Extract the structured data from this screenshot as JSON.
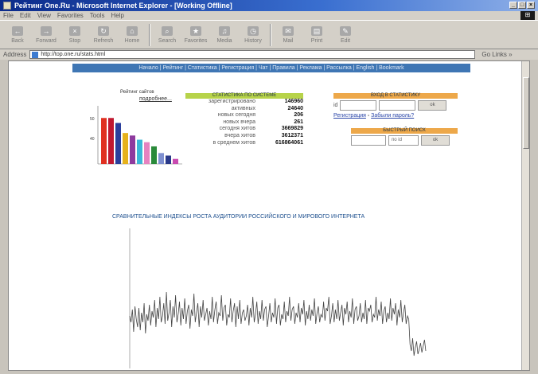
{
  "window": {
    "title": "Рейтинг One.Ru - Microsoft Internet Explorer - [Working Offline]"
  },
  "menu": [
    "File",
    "Edit",
    "View",
    "Favorites",
    "Tools",
    "Help"
  ],
  "toolbar": [
    "Back",
    "Forward",
    "Stop",
    "Refresh",
    "Home",
    "Search",
    "Favorites",
    "Media",
    "History",
    "Mail",
    "Print",
    "Edit"
  ],
  "address": {
    "label": "Address",
    "url": "http://top.one.ru/stats.html",
    "go": "Go  Links »"
  },
  "nav": {
    "text": "Начало | Рейтинг | Статистика | Регистрация | Чат | Правила | Реклама | Рассылка | English | Bookmark"
  },
  "mini_chart": {
    "title": "Рейтинг сайтов",
    "more": "подробнее...",
    "ymax": "50",
    "ymid": "40",
    "colors": [
      "#e03020",
      "#c01830",
      "#2b3f9c",
      "#e6b21c",
      "#8e3b9e",
      "#3bb8d8",
      "#e682c0",
      "#2a8a3a",
      "#7e8fd0",
      "#2a3a8a",
      "#c84ab0"
    ],
    "chart_data": {
      "type": "bar",
      "values": [
        55,
        55,
        49,
        37,
        34,
        29,
        26,
        21,
        13,
        10,
        6
      ]
    }
  },
  "stats": {
    "header": "СТАТИСТИКА ПО СИСТЕМЕ",
    "rows": [
      {
        "label": "зарегистрировано",
        "value": "146960"
      },
      {
        "label": "активных",
        "value": "24640"
      },
      {
        "label": "новых сегодня",
        "value": "206"
      },
      {
        "label": "новых вчера",
        "value": "261"
      },
      {
        "label": "сегодня хитов",
        "value": "3669829"
      },
      {
        "label": "вчера хитов",
        "value": "3612371"
      },
      {
        "label": "в среднем хитов",
        "value": "616864061"
      }
    ]
  },
  "login": {
    "header": "ВХОД В СТАТИСТИКУ",
    "prefix": "id",
    "button": "ok",
    "link_register": "Регистрация",
    "link_forgot": "Забыли пароль?"
  },
  "quick_search": {
    "header": "БЫСТРЫЙ ПОИСК",
    "select": "по id",
    "button": "ok"
  },
  "index_chart": {
    "title": "СРАВНИТЕЛЬНЫЕ ИНДЕКСЫ РОСТА АУДИТОРИИ РОССИЙСКОГО И МИРОВОГО ИНТЕРНЕТА",
    "chart_data": {
      "type": "line",
      "values": [
        40,
        36,
        44,
        30,
        46,
        38,
        33,
        45,
        31,
        42,
        36,
        48,
        29,
        41,
        37,
        47,
        34,
        43,
        39,
        50,
        33,
        45,
        38,
        52,
        36,
        40,
        48,
        35,
        55,
        37,
        42,
        50,
        33,
        46,
        39,
        53,
        36,
        41,
        49,
        34,
        45,
        38,
        51,
        35,
        43,
        47,
        32,
        44,
        40,
        54,
        36,
        42,
        48,
        33,
        46,
        39,
        50,
        37,
        41,
        45,
        34,
        43,
        38,
        52,
        36,
        44,
        49,
        35,
        42,
        40,
        53,
        37,
        45,
        47,
        34,
        41,
        39,
        51,
        36,
        43,
        48,
        33,
        46,
        38,
        50,
        35,
        42,
        44,
        37,
        40,
        47,
        34,
        45,
        39,
        52,
        36,
        41,
        49,
        35,
        43,
        38,
        50,
        37,
        44,
        46,
        33,
        40,
        48,
        36,
        42,
        39,
        51,
        35,
        45,
        47,
        34,
        41,
        38,
        49,
        36,
        43,
        40,
        52,
        37,
        44,
        46,
        35,
        42,
        39,
        48,
        36,
        45,
        41,
        50,
        34,
        43,
        38,
        47,
        37,
        44,
        40,
        51,
        35,
        42,
        46,
        36,
        41,
        39,
        49,
        37,
        45,
        43,
        52,
        35,
        40,
        48,
        36,
        44,
        38,
        50,
        37,
        42,
        47,
        34,
        45,
        41,
        49,
        36,
        43,
        39,
        51,
        35,
        44,
        46,
        37,
        40,
        48,
        36,
        42,
        38,
        50,
        35,
        45,
        43,
        47,
        36,
        41,
        39,
        52,
        37,
        44,
        40,
        49,
        35,
        43,
        46,
        36,
        42,
        38,
        51,
        37,
        45,
        41,
        48,
        34,
        44,
        39,
        50,
        36,
        42,
        47,
        35,
        40,
        38,
        22,
        18,
        26,
        15,
        20,
        24,
        16,
        19,
        23,
        17,
        21,
        25,
        18
      ]
    }
  }
}
